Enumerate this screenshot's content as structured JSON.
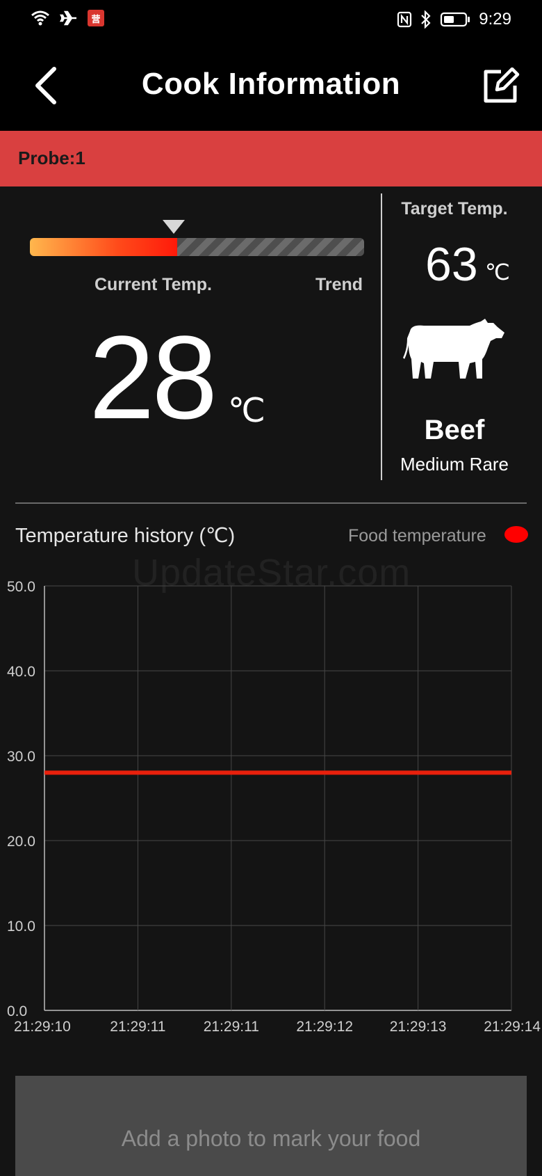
{
  "status_bar": {
    "time": "9:29",
    "icons": [
      "wifi-icon",
      "airplane-mode-icon",
      "app-notification-icon",
      "nfc-icon",
      "bluetooth-icon",
      "battery-icon"
    ],
    "app_badge_glyph": "营"
  },
  "header": {
    "title": "Cook Information",
    "back_icon": "chevron-left-icon",
    "edit_icon": "edit-icon"
  },
  "probe": {
    "label": "Probe:1",
    "banner_color": "#d94040"
  },
  "current": {
    "label": "Current Temp.",
    "trend_label": "Trend",
    "value": "28",
    "unit": "℃",
    "trend_progress": 0.44
  },
  "target": {
    "label": "Target Temp.",
    "value": "63",
    "unit": "℃",
    "food_icon": "cow-icon",
    "food": "Beef",
    "doneness": "Medium Rare"
  },
  "history": {
    "title": "Temperature history (℃)",
    "legend_label": "Food temperature",
    "legend_color": "#ff0000"
  },
  "watermark": "UpdateStar.com",
  "chart_data": {
    "type": "line",
    "title": "Temperature history (℃)",
    "x": [
      "21:29:10",
      "21:29:11",
      "21:29:11",
      "21:29:12",
      "21:29:13",
      "21:29:14"
    ],
    "y_ticks": [
      "0.0",
      "10.0",
      "20.0",
      "30.0",
      "40.0",
      "50.0"
    ],
    "ylim": [
      0,
      50
    ],
    "grid": true,
    "legend": "top-right",
    "series": [
      {
        "name": "Food temperature",
        "color": "#e8200c",
        "values": [
          28,
          28,
          28,
          28,
          28,
          28
        ]
      }
    ]
  },
  "photo": {
    "prompt": "Add a photo to mark your food"
  }
}
